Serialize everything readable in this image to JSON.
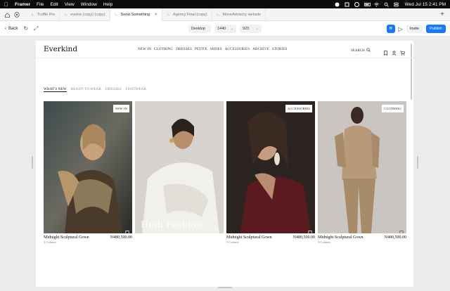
{
  "menubar": {
    "app": "Framer",
    "items": [
      "File",
      "Edit",
      "View",
      "Window",
      "Help"
    ],
    "clock": "Wed Jul 15  2:41 PM"
  },
  "tabs": [
    {
      "label": "Truffle Pro",
      "active": false
    },
    {
      "label": "evelos (copy) (copy)",
      "active": false
    },
    {
      "label": "Snow Something",
      "active": true
    },
    {
      "label": "Agency Final (copy)",
      "active": false
    },
    {
      "label": "MoveAdvisory website",
      "active": false
    }
  ],
  "toolbar": {
    "back_label": "Back",
    "breakpoint": "Desktop",
    "width": "1440",
    "height": "923",
    "invite_label": "Invite",
    "publish_label": "Publish",
    "avatar_initial": "H"
  },
  "site": {
    "logo": "Everkind",
    "nav": [
      "NEW IN",
      "CLOTHING",
      "DRESSES",
      "PETITE",
      "SHOES",
      "ACCESSORIES",
      "ARCHIVE",
      "STORIES"
    ],
    "search_label": "SEARCH",
    "filters": [
      "WHAT'S NEW",
      "READY TO WEAR",
      "DRESSES",
      "FOOTWEAR"
    ],
    "active_filter": "WHAT'S NEW"
  },
  "products": [
    {
      "badge": "NEW IN",
      "name": "Midnight Sculptural Gown",
      "price": "N480,500.00",
      "colours": "3 Colours",
      "overlay": ""
    },
    {
      "badge": "",
      "name": "",
      "price": "",
      "colours": "",
      "overlay": "High Fashion"
    },
    {
      "badge": "ACCESSORIES",
      "name": "Midnight Sculptural Gown",
      "price": "N480,500.00",
      "colours": "3 Colours",
      "overlay": ""
    },
    {
      "badge": "CLOTHING",
      "name": "Midnight Sculptural Gown",
      "price": "N480,500.00",
      "colours": "3 Colours",
      "overlay": ""
    }
  ],
  "colors": {
    "accent": "#1677ff",
    "menubar": "#0b0b0b"
  }
}
